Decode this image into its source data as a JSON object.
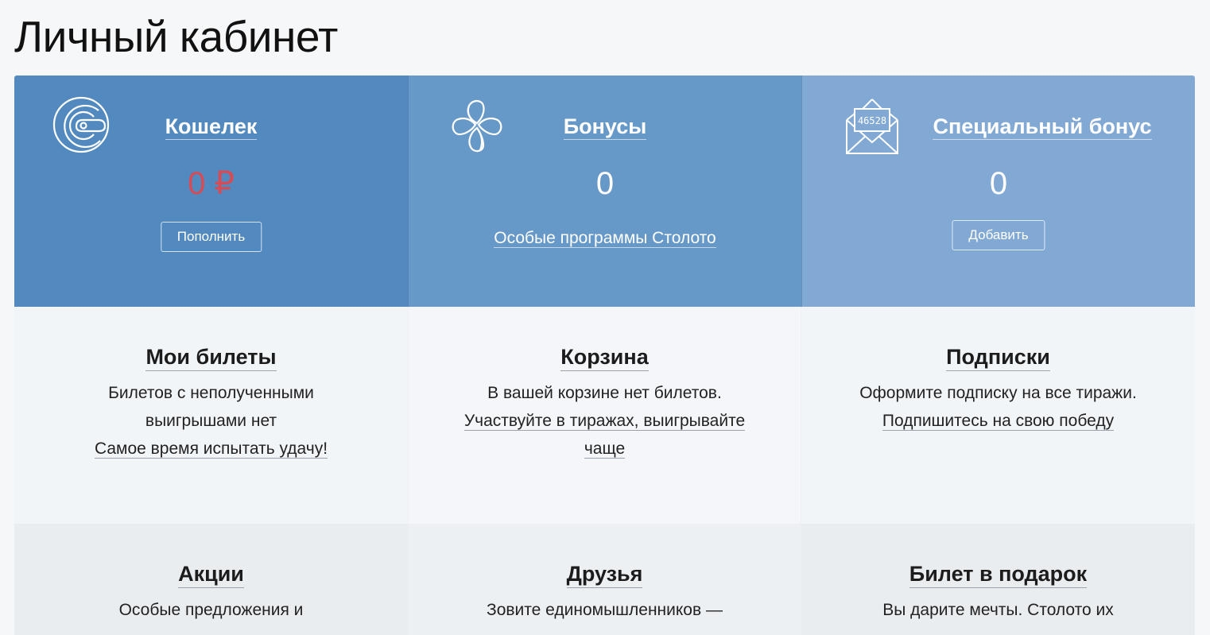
{
  "page": {
    "title": "Личный кабинет"
  },
  "top": {
    "wallet": {
      "title": "Кошелек",
      "value": "0 ₽",
      "button": "Пополнить"
    },
    "bonus": {
      "title": "Бонусы",
      "value": "0",
      "link": "Особые программы Столото"
    },
    "special": {
      "title": "Специальный бонус",
      "value": "0",
      "button": "Добавить",
      "envelope_number": "46528"
    }
  },
  "tiles": {
    "tickets": {
      "title": "Мои билеты",
      "line1": "Билетов с неполученными",
      "line2": "выигрышами нет",
      "link": "Самое время испытать удачу!"
    },
    "cart": {
      "title": "Корзина",
      "line1": "В вашей корзине нет билетов.",
      "link1": "Участвуйте в тиражах, выигрывайте",
      "link2": "чаще"
    },
    "subscriptions": {
      "title": "Подписки",
      "line1": "Оформите подписку на все тиражи.",
      "link": "Подпишитесь на свою победу"
    },
    "promo": {
      "title": "Акции",
      "line1": "Особые предложения и"
    },
    "friends": {
      "title": "Друзья",
      "line1": "Зовите единомышленников —"
    },
    "gift": {
      "title": "Билет в подарок",
      "line1": "Вы дарите мечты. Столото их"
    }
  }
}
